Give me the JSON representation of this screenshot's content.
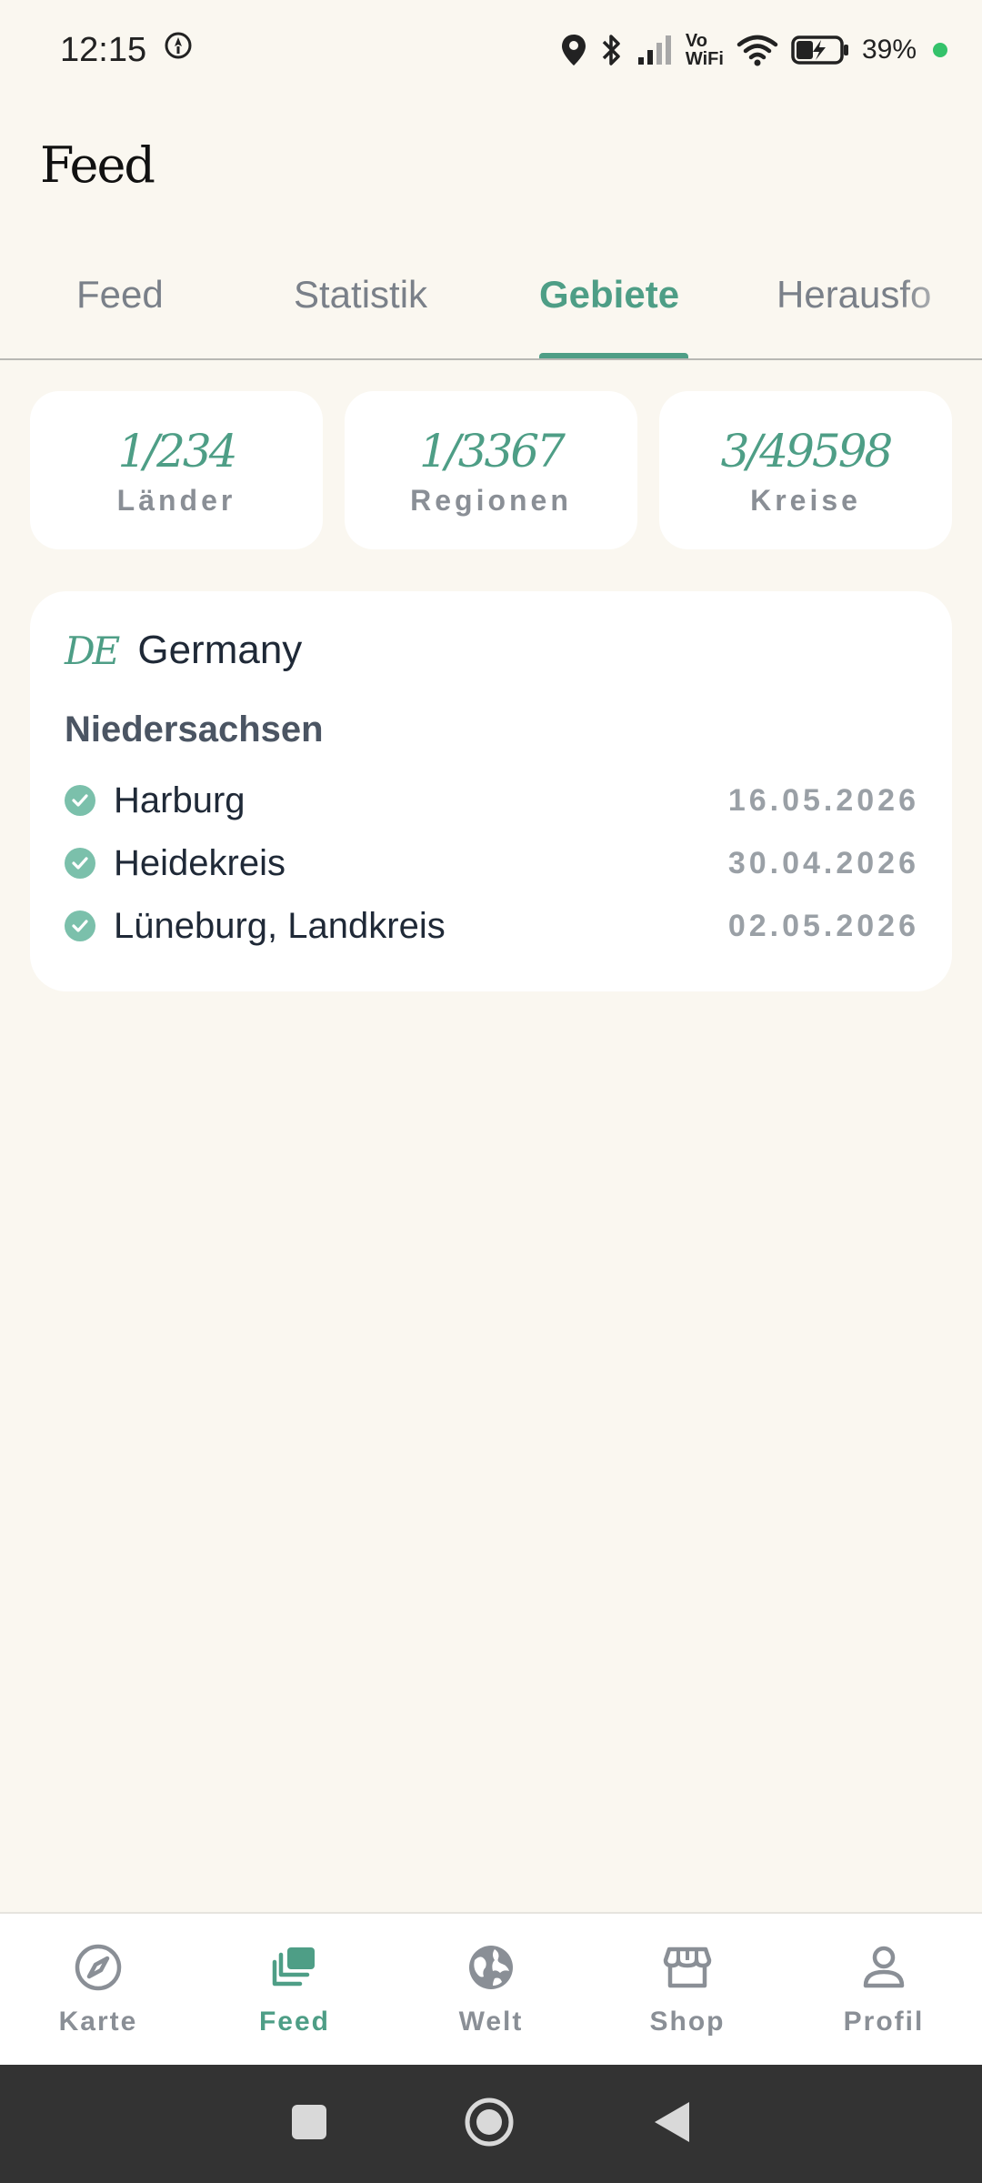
{
  "status_bar": {
    "time": "12:15",
    "battery": "39%",
    "vowifi_top": "Vo",
    "vowifi_bottom": "WiFi"
  },
  "header": {
    "title": "Feed"
  },
  "tabs": [
    {
      "label": "Feed",
      "active": false
    },
    {
      "label": "Statistik",
      "active": false
    },
    {
      "label": "Gebiete",
      "active": true
    },
    {
      "label": "Herausfo",
      "active": false
    }
  ],
  "stats": [
    {
      "value": "1/234",
      "label": "Länder"
    },
    {
      "value": "1/3367",
      "label": "Regionen"
    },
    {
      "value": "3/49598",
      "label": "Kreise"
    }
  ],
  "region_card": {
    "country_code": "DE",
    "country_name": "Germany",
    "region_name": "Niedersachsen",
    "districts": [
      {
        "name": "Harburg",
        "date": "16.05.2026"
      },
      {
        "name": "Heidekreis",
        "date": "30.04.2026"
      },
      {
        "name": "Lüneburg, Landkreis",
        "date": "02.05.2026"
      }
    ]
  },
  "bottom_nav": [
    {
      "label": "Karte",
      "icon": "compass-icon",
      "active": false
    },
    {
      "label": "Feed",
      "icon": "feed-icon",
      "active": true
    },
    {
      "label": "Welt",
      "icon": "globe-icon",
      "active": false
    },
    {
      "label": "Shop",
      "icon": "store-icon",
      "active": false
    },
    {
      "label": "Profil",
      "icon": "person-icon",
      "active": false
    }
  ],
  "colors": {
    "accent": "#4E9E86",
    "background": "#FAF7F0",
    "card": "#FFFFFF",
    "muted": "#8A8F96"
  }
}
